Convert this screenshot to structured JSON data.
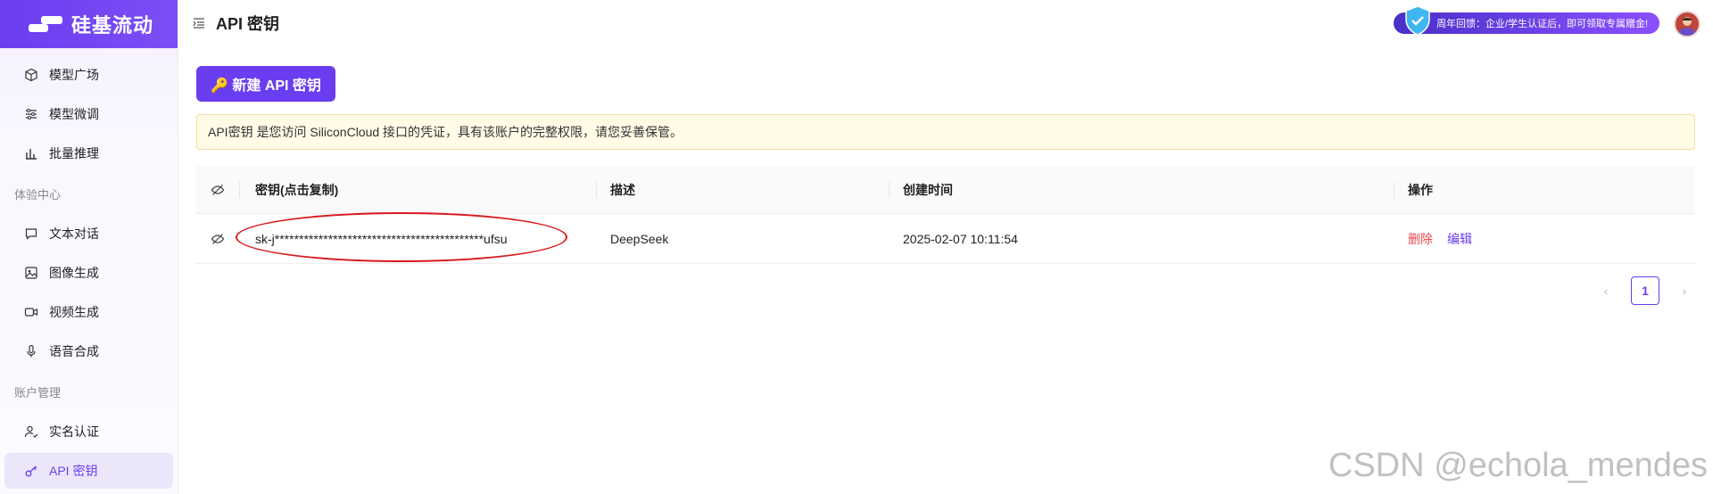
{
  "app": {
    "brand": "硅基流动"
  },
  "sidebar": {
    "top_items": [
      {
        "label": "模型广场",
        "icon": "cube-icon"
      },
      {
        "label": "模型微调",
        "icon": "sliders-icon"
      },
      {
        "label": "批量推理",
        "icon": "chart-icon"
      }
    ],
    "section1": "体验中心",
    "experience_items": [
      {
        "label": "文本对话",
        "icon": "chat-icon"
      },
      {
        "label": "图像生成",
        "icon": "image-icon"
      },
      {
        "label": "视频生成",
        "icon": "video-icon"
      },
      {
        "label": "语音合成",
        "icon": "mic-icon"
      }
    ],
    "section2": "账户管理",
    "account_items": [
      {
        "label": "实名认证",
        "icon": "user-check-icon"
      },
      {
        "label": "API 密钥",
        "icon": "key-icon",
        "active": true
      }
    ]
  },
  "header": {
    "title": "API 密钥",
    "promo": "周年回馈：企业/学生认证后，即可领取专属赠金!"
  },
  "main": {
    "new_button": "🔑 新建 API 密钥",
    "notice": "API密钥 是您访问 SiliconCloud 接口的凭证，具有该账户的完整权限，请您妥善保管。",
    "table": {
      "headers": [
        "密钥(点击复制)",
        "描述",
        "创建时间",
        "操作"
      ],
      "rows": [
        {
          "key": "sk-j*******************************************ufsu",
          "description": "DeepSeek",
          "created": "2025-02-07 10:11:54",
          "delete": "删除",
          "edit": "编辑"
        }
      ]
    },
    "pagination": {
      "current": "1",
      "prev": "‹",
      "next": "›"
    }
  },
  "watermark": "CSDN @echola_mendes",
  "colors": {
    "accent": "#6a3df0",
    "danger": "#e5484d",
    "notice_bg": "#fffbe6"
  }
}
